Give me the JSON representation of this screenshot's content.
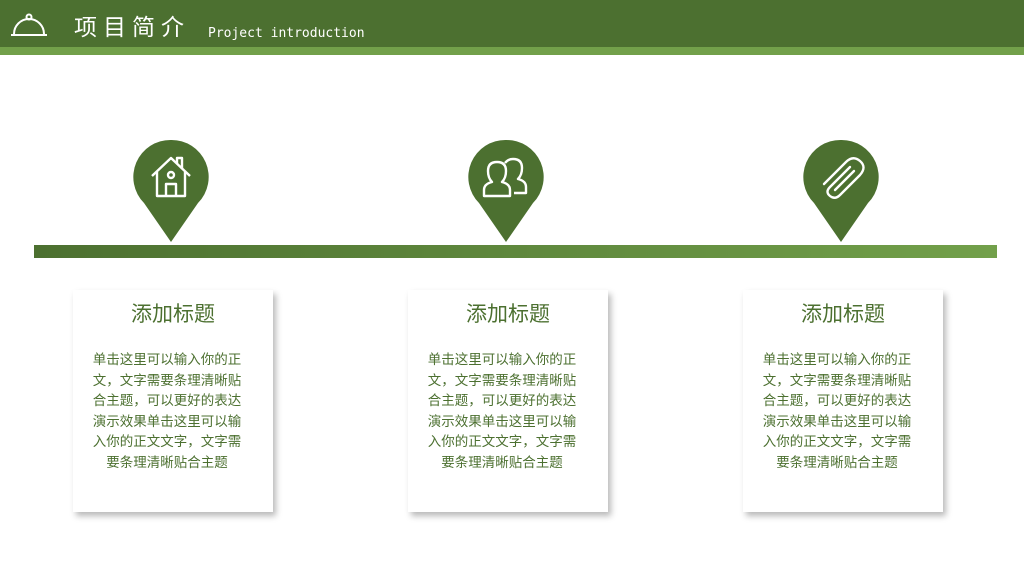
{
  "header": {
    "title": "项目简介",
    "subtitle": "Project introduction",
    "icon": "cloche-icon"
  },
  "colors": {
    "primary": "#4c7030",
    "accent": "#72a04a",
    "background": "#ffffff"
  },
  "items": [
    {
      "icon": "home-icon",
      "title": "添加标题",
      "body": "单击这里可以输入你的正文，文字需要条理清晰贴合主题，可以更好的表达演示效果单击这里可以输入你的正文文字，文字需要条理清晰贴合主题"
    },
    {
      "icon": "users-icon",
      "title": "添加标题",
      "body": "单击这里可以输入你的正文，文字需要条理清晰贴合主题，可以更好的表达演示效果单击这里可以输入你的正文文字，文字需要条理清晰贴合主题"
    },
    {
      "icon": "paperclip-icon",
      "title": "添加标题",
      "body": "单击这里可以输入你的正文，文字需要条理清晰贴合主题，可以更好的表达演示效果单击这里可以输入你的正文文字，文字需要条理清晰贴合主题"
    }
  ]
}
